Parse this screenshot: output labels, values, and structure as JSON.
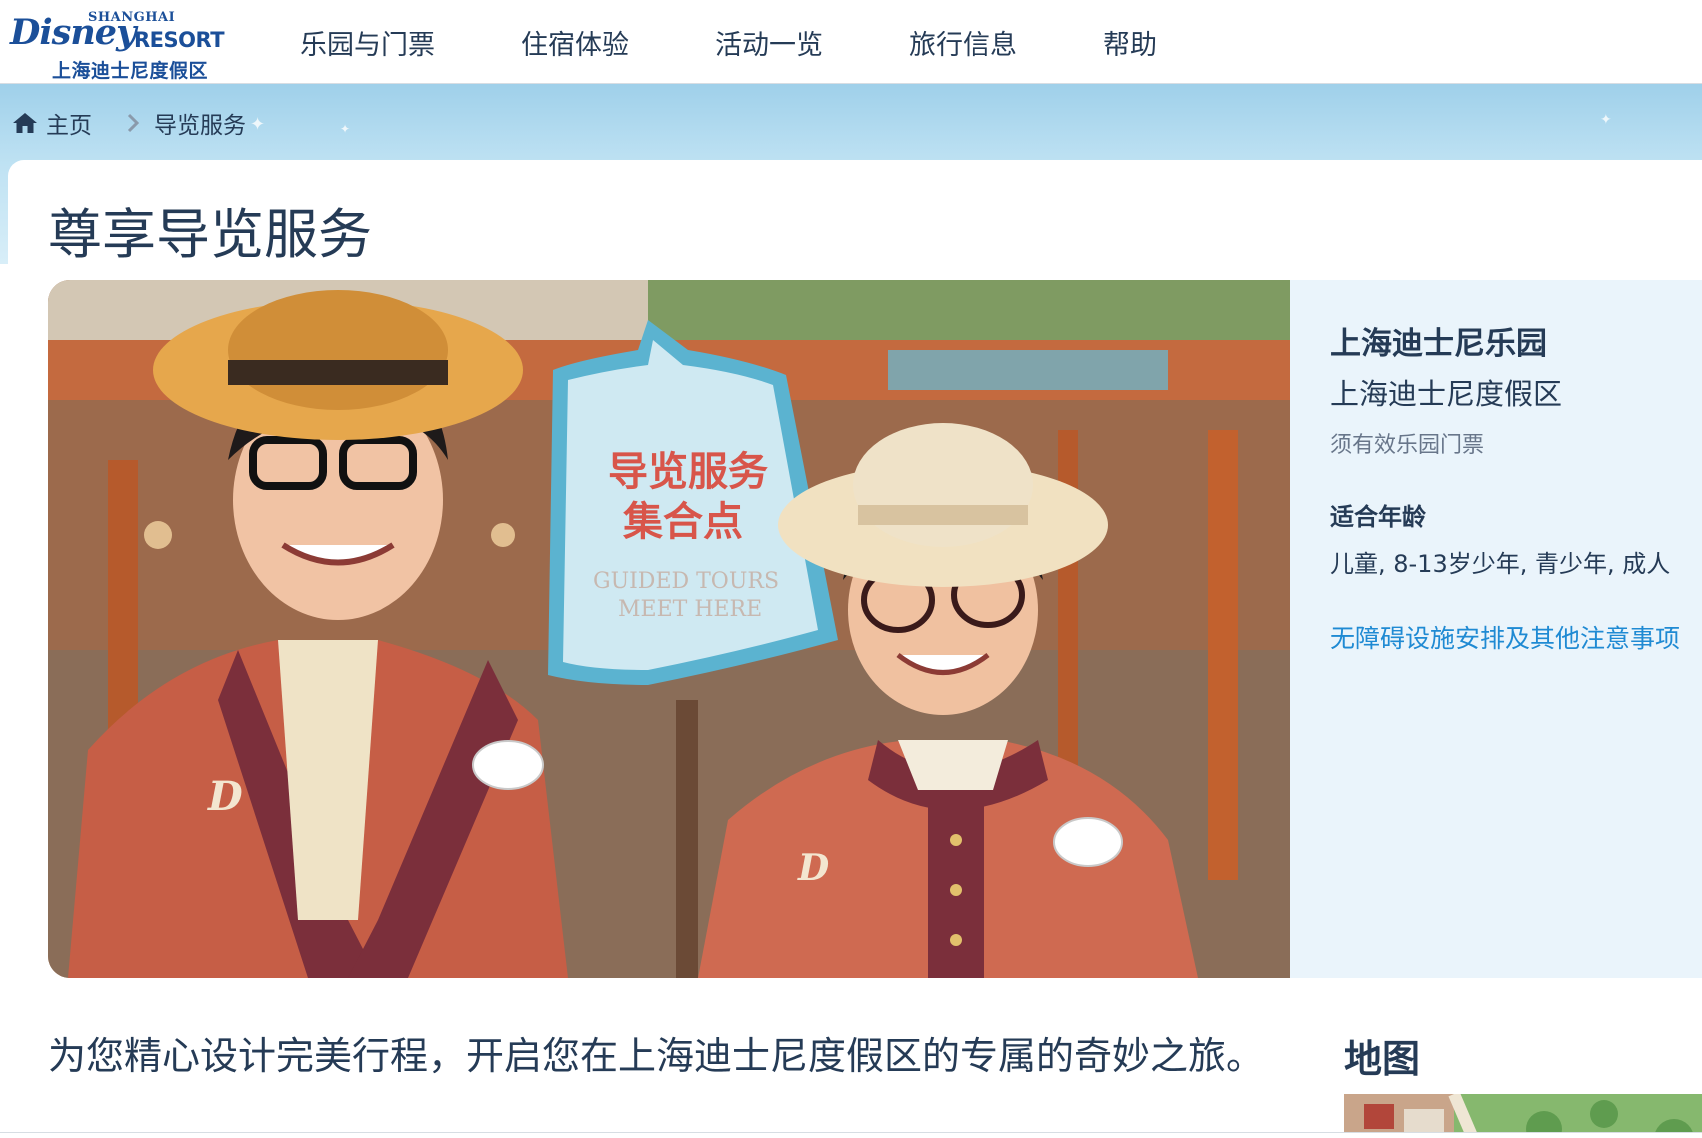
{
  "logo": {
    "shanghai": "SHANGHAI",
    "disney": "Disney",
    "resort": "RESORT",
    "cn": "上海迪士尼度假区"
  },
  "nav": {
    "items": [
      {
        "label": "乐园与门票"
      },
      {
        "label": "住宿体验"
      },
      {
        "label": "活动一览"
      },
      {
        "label": "旅行信息"
      },
      {
        "label": "帮助"
      }
    ]
  },
  "breadcrumb": {
    "home": "主页",
    "current": "导览服务"
  },
  "page": {
    "title": "尊享导览服务"
  },
  "hero": {
    "sign_line1": "导览服务",
    "sign_line2": "集合点",
    "sign_en1": "GUIDED TOURS",
    "sign_en2": "MEET HERE"
  },
  "info": {
    "park": "上海迪士尼乐园",
    "resort": "上海迪士尼度假区",
    "ticket": "须有效乐园门票",
    "age_heading": "适合年龄",
    "ages": "儿童, 8-13岁少年, 青少年, 成人",
    "accessibility_link": "无障碍设施安排及其他注意事项"
  },
  "content": {
    "description": "为您精心设计完美行程，开启您在上海迪士尼度假区的专属的奇妙之旅。",
    "map_heading": "地图"
  },
  "colors": {
    "brand": "#1b4f99",
    "text": "#253b56",
    "link": "#1f8ad3",
    "panel": "#eaf4fb",
    "band": "#bfe2f3"
  }
}
